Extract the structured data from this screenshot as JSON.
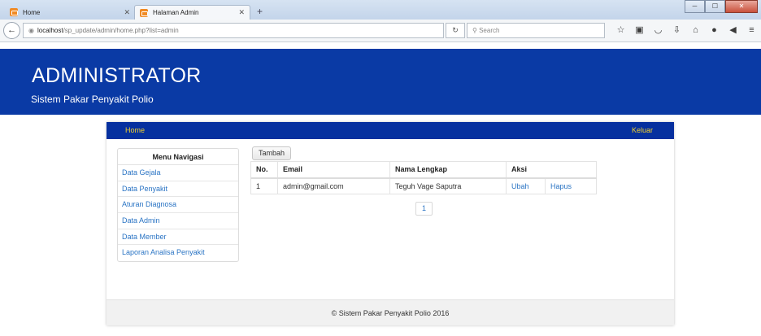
{
  "browser": {
    "tabs": [
      {
        "label": "Home",
        "active": false
      },
      {
        "label": "Halaman Admin",
        "active": true
      }
    ],
    "new_tab": "+",
    "url_host": "localhost",
    "url_path": "/sp_update/admin/home.php?list=admin",
    "search_placeholder": "Search",
    "window_controls": [
      "minimize",
      "maximize",
      "close"
    ]
  },
  "header": {
    "title": "ADMINISTRATOR",
    "subtitle": "Sistem Pakar Penyakit Polio"
  },
  "topnav": {
    "home": "Home",
    "logout": "Keluar"
  },
  "sidebar": {
    "heading": "Menu Navigasi",
    "items": [
      {
        "label": "Data Gejala"
      },
      {
        "label": "Data Penyakit"
      },
      {
        "label": "Aturan Diagnosa"
      },
      {
        "label": "Data Admin"
      },
      {
        "label": "Data Member"
      },
      {
        "label": "Laporan Analisa Penyakit"
      }
    ]
  },
  "main": {
    "add_button": "Tambah",
    "table": {
      "headers": [
        "No.",
        "Email",
        "Nama Lengkap",
        "Aksi"
      ],
      "rows": [
        {
          "no": "1",
          "email": "admin@gmail.com",
          "name": "Teguh Vage Saputra",
          "edit": "Ubah",
          "delete": "Hapus"
        }
      ]
    },
    "pagination": {
      "current_page": "1"
    }
  },
  "footer": {
    "text": "© Sistem Pakar Penyakit Polio 2016"
  },
  "colors": {
    "banner": "#0a3aa5",
    "nav": "#06309f",
    "nav_link": "#f3d12c",
    "link": "#2a74c4"
  }
}
